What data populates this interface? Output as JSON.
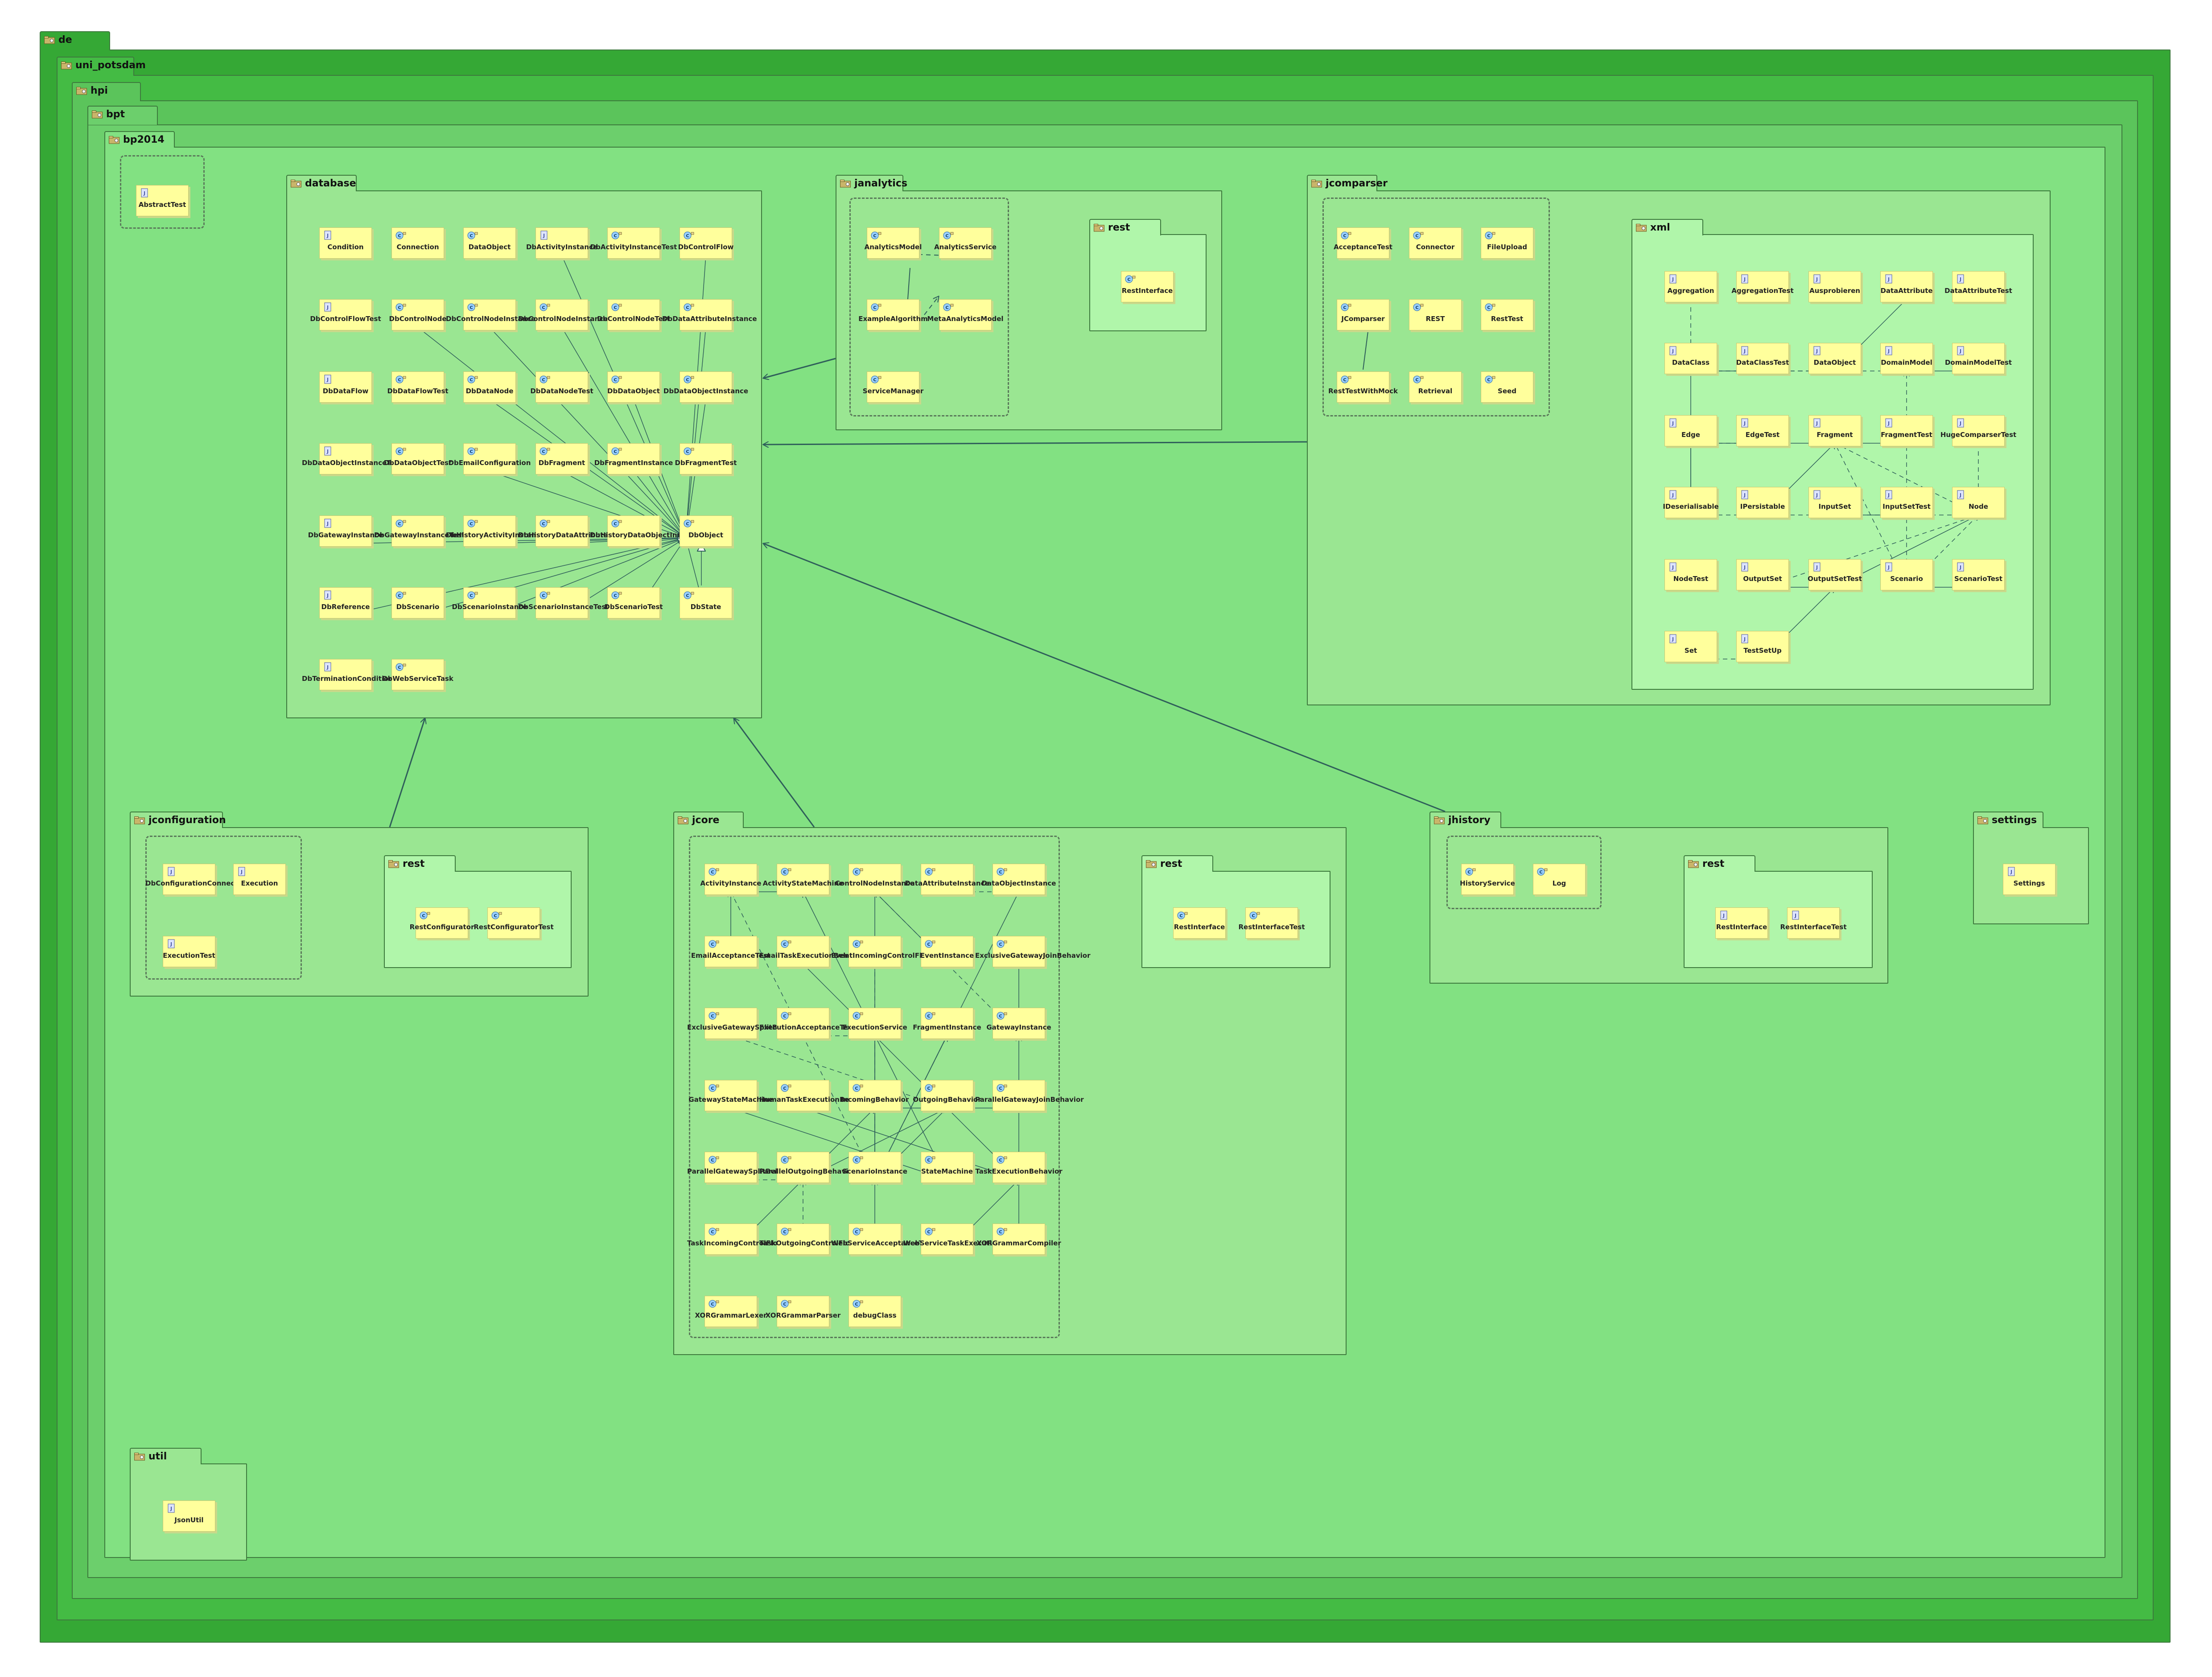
{
  "packages": [
    {
      "id": "de",
      "name": "de"
    },
    {
      "id": "uni_potsdam",
      "name": "uni_potsdam"
    },
    {
      "id": "hpi",
      "name": "hpi"
    },
    {
      "id": "bpt",
      "name": "bpt"
    },
    {
      "id": "bp2014",
      "name": "bp2014"
    },
    {
      "id": "database",
      "name": "database"
    },
    {
      "id": "janalytics",
      "name": "janalytics"
    },
    {
      "id": "janalytics_rest",
      "name": "rest"
    },
    {
      "id": "jcomparser",
      "name": "jcomparser"
    },
    {
      "id": "xml",
      "name": "xml"
    },
    {
      "id": "jconfiguration",
      "name": "jconfiguration"
    },
    {
      "id": "jconfiguration_rest",
      "name": "rest"
    },
    {
      "id": "jcore",
      "name": "jcore"
    },
    {
      "id": "jcore_rest",
      "name": "rest"
    },
    {
      "id": "jhistory",
      "name": "jhistory"
    },
    {
      "id": "jhistory_rest",
      "name": "rest"
    },
    {
      "id": "settings",
      "name": "settings"
    },
    {
      "id": "util",
      "name": "util"
    }
  ],
  "classes": [
    {
      "id": "AbstractTest",
      "name": "AbstractTest",
      "kind": "interface-icon"
    },
    {
      "id": "db_Condition",
      "name": "Condition",
      "kind": "interface-icon"
    },
    {
      "id": "db_Connection",
      "name": "Connection",
      "kind": "class-icon"
    },
    {
      "id": "db_DataObject",
      "name": "DataObject",
      "kind": "class-icon"
    },
    {
      "id": "db_DbActivityInstance",
      "name": "DbActivityInstance",
      "kind": "interface-icon"
    },
    {
      "id": "db_DbActivityInstanceTest",
      "name": "DbActivityInstanceTest",
      "kind": "class-icon"
    },
    {
      "id": "db_DbControlFlow",
      "name": "DbControlFlow",
      "kind": "class-icon"
    },
    {
      "id": "db_DbControlFlowTest",
      "name": "DbControlFlowTest",
      "kind": "interface-icon"
    },
    {
      "id": "db_DbControlNode",
      "name": "DbControlNode",
      "kind": "class-icon"
    },
    {
      "id": "db_DbControlNodeInstance",
      "name": "DbControlNodeInstance",
      "kind": "class-icon"
    },
    {
      "id": "db_DbControlNodeInstanceTest",
      "name": "DbControlNodeInstanceTest",
      "kind": "class-icon"
    },
    {
      "id": "db_DbControlNodeTest",
      "name": "DbControlNodeTest",
      "kind": "class-icon"
    },
    {
      "id": "db_DbDataAttributeInstance",
      "name": "DbDataAttributeInstance",
      "kind": "class-icon"
    },
    {
      "id": "db_DbDataFlow",
      "name": "DbDataFlow",
      "kind": "interface-icon"
    },
    {
      "id": "db_DbDataFlowTest",
      "name": "DbDataFlowTest",
      "kind": "class-icon"
    },
    {
      "id": "db_DbDataNode",
      "name": "DbDataNode",
      "kind": "class-icon"
    },
    {
      "id": "db_DbDataNodeTest",
      "name": "DbDataNodeTest",
      "kind": "class-icon"
    },
    {
      "id": "db_DbDataObject",
      "name": "DbDataObject",
      "kind": "class-icon"
    },
    {
      "id": "db_DbDataObjectInstance",
      "name": "DbDataObjectInstance",
      "kind": "class-icon"
    },
    {
      "id": "db_DbDataObjectInstanceTest",
      "name": "DbDataObjectInstanceTest",
      "kind": "interface-icon"
    },
    {
      "id": "db_DbDataObjectTest",
      "name": "DbDataObjectTest",
      "kind": "class-icon"
    },
    {
      "id": "db_DbEmailConfiguration",
      "name": "DbEmailConfiguration",
      "kind": "class-icon"
    },
    {
      "id": "db_DbFragment",
      "name": "DbFragment",
      "kind": "class-icon"
    },
    {
      "id": "db_DbFragmentInstance",
      "name": "DbFragmentInstance",
      "kind": "class-icon"
    },
    {
      "id": "db_DbFragmentTest",
      "name": "DbFragmentTest",
      "kind": "class-icon"
    },
    {
      "id": "db_DbGatewayInstance",
      "name": "DbGatewayInstance",
      "kind": "interface-icon"
    },
    {
      "id": "db_DbGatewayInstanceTest",
      "name": "DbGatewayInstanceTest",
      "kind": "class-icon"
    },
    {
      "id": "db_DbHistoryActivityInstance",
      "name": "DbHistoryActivityInstance",
      "kind": "class-icon"
    },
    {
      "id": "db_DbHistoryDataAttributeInstance",
      "name": "DbHistoryDataAttributeInstance",
      "kind": "class-icon"
    },
    {
      "id": "db_DbHistoryDataObjectInstance",
      "name": "DbHistoryDataObjectInstance",
      "kind": "class-icon"
    },
    {
      "id": "db_DbObject",
      "name": "DbObject",
      "kind": "class-icon"
    },
    {
      "id": "db_DbReference",
      "name": "DbReference",
      "kind": "interface-icon"
    },
    {
      "id": "db_DbScenario",
      "name": "DbScenario",
      "kind": "class-icon"
    },
    {
      "id": "db_DbScenarioInstance",
      "name": "DbScenarioInstance",
      "kind": "class-icon"
    },
    {
      "id": "db_DbScenarioInstanceTest",
      "name": "DbScenarioInstanceTest",
      "kind": "class-icon"
    },
    {
      "id": "db_DbScenarioTest",
      "name": "DbScenarioTest",
      "kind": "class-icon"
    },
    {
      "id": "db_DbState",
      "name": "DbState",
      "kind": "class-icon"
    },
    {
      "id": "db_DbTerminationCondition",
      "name": "DbTerminationCondition",
      "kind": "interface-icon"
    },
    {
      "id": "db_DbWebServiceTask",
      "name": "DbWebServiceTask",
      "kind": "class-icon"
    },
    {
      "id": "an_AnalyticsModel",
      "name": "AnalyticsModel",
      "kind": "class-icon"
    },
    {
      "id": "an_AnalyticsService",
      "name": "AnalyticsService",
      "kind": "class-icon"
    },
    {
      "id": "an_ExampleAlgorithm",
      "name": "ExampleAlgorithm",
      "kind": "class-icon"
    },
    {
      "id": "an_MetaAnalyticsModel",
      "name": "MetaAnalyticsModel",
      "kind": "class-icon"
    },
    {
      "id": "an_ServiceManager",
      "name": "ServiceManager",
      "kind": "class-icon"
    },
    {
      "id": "an_RestInterface",
      "name": "RestInterface",
      "kind": "class-icon"
    },
    {
      "id": "jc_AcceptanceTest",
      "name": "AcceptanceTest",
      "kind": "class-icon"
    },
    {
      "id": "jc_Connector",
      "name": "Connector",
      "kind": "class-icon"
    },
    {
      "id": "jc_FileUpload",
      "name": "FileUpload",
      "kind": "class-icon"
    },
    {
      "id": "jc_JComparser",
      "name": "JComparser",
      "kind": "class-icon"
    },
    {
      "id": "jc_REST",
      "name": "REST",
      "kind": "class-icon"
    },
    {
      "id": "jc_RestTest",
      "name": "RestTest",
      "kind": "class-icon"
    },
    {
      "id": "jc_RestTestWithMock",
      "name": "RestTestWithMock",
      "kind": "class-icon"
    },
    {
      "id": "jc_Retrieval",
      "name": "Retrieval",
      "kind": "class-icon"
    },
    {
      "id": "jc_Seed",
      "name": "Seed",
      "kind": "class-icon"
    },
    {
      "id": "x_Aggregation",
      "name": "Aggregation",
      "kind": "interface-icon"
    },
    {
      "id": "x_AggregationTest",
      "name": "AggregationTest",
      "kind": "interface-icon"
    },
    {
      "id": "x_Ausprobieren",
      "name": "Ausprobieren",
      "kind": "interface-icon"
    },
    {
      "id": "x_DataAttribute",
      "name": "DataAttribute",
      "kind": "interface-icon"
    },
    {
      "id": "x_DataAttributeTest",
      "name": "DataAttributeTest",
      "kind": "interface-icon"
    },
    {
      "id": "x_DataClass",
      "name": "DataClass",
      "kind": "interface-icon"
    },
    {
      "id": "x_DataClassTest",
      "name": "DataClassTest",
      "kind": "interface-icon"
    },
    {
      "id": "x_DataObject",
      "name": "DataObject",
      "kind": "interface-icon"
    },
    {
      "id": "x_DomainModel",
      "name": "DomainModel",
      "kind": "interface-icon"
    },
    {
      "id": "x_DomainModelTest",
      "name": "DomainModelTest",
      "kind": "interface-icon"
    },
    {
      "id": "x_Edge",
      "name": "Edge",
      "kind": "interface-icon"
    },
    {
      "id": "x_EdgeTest",
      "name": "EdgeTest",
      "kind": "interface-icon"
    },
    {
      "id": "x_Fragment",
      "name": "Fragment",
      "kind": "interface-icon"
    },
    {
      "id": "x_FragmentTest",
      "name": "FragmentTest",
      "kind": "interface-icon"
    },
    {
      "id": "x_HugeComparserTest",
      "name": "HugeComparserTest",
      "kind": "interface-icon"
    },
    {
      "id": "x_IDeserialisable",
      "name": "IDeserialisable",
      "kind": "interface-icon"
    },
    {
      "id": "x_IPersistable",
      "name": "IPersistable",
      "kind": "interface-icon"
    },
    {
      "id": "x_InputSet",
      "name": "InputSet",
      "kind": "interface-icon"
    },
    {
      "id": "x_InputSetTest",
      "name": "InputSetTest",
      "kind": "interface-icon"
    },
    {
      "id": "x_Node",
      "name": "Node",
      "kind": "interface-icon"
    },
    {
      "id": "x_NodeTest",
      "name": "NodeTest",
      "kind": "interface-icon"
    },
    {
      "id": "x_OutputSet",
      "name": "OutputSet",
      "kind": "interface-icon"
    },
    {
      "id": "x_OutputSetTest",
      "name": "OutputSetTest",
      "kind": "interface-icon"
    },
    {
      "id": "x_Scenario",
      "name": "Scenario",
      "kind": "interface-icon"
    },
    {
      "id": "x_ScenarioTest",
      "name": "ScenarioTest",
      "kind": "interface-icon"
    },
    {
      "id": "x_Set",
      "name": "Set",
      "kind": "interface-icon"
    },
    {
      "id": "x_TestSetUp",
      "name": "TestSetUp",
      "kind": "interface-icon"
    },
    {
      "id": "cf_DbConfigurationConnection",
      "name": "DbConfigurationConnection",
      "kind": "interface-icon"
    },
    {
      "id": "cf_Execution",
      "name": "Execution",
      "kind": "interface-icon"
    },
    {
      "id": "cf_ExecutionTest",
      "name": "ExecutionTest",
      "kind": "interface-icon"
    },
    {
      "id": "cf_RestConfigurator",
      "name": "RestConfigurator",
      "kind": "class-icon"
    },
    {
      "id": "cf_RestConfiguratorTest",
      "name": "RestConfiguratorTest",
      "kind": "class-icon"
    },
    {
      "id": "co_ActivityInstance",
      "name": "ActivityInstance",
      "kind": "class-icon"
    },
    {
      "id": "co_ActivityStateMachine",
      "name": "ActivityStateMachine",
      "kind": "class-icon"
    },
    {
      "id": "co_ControlNodeInstance",
      "name": "ControlNodeInstance",
      "kind": "class-icon"
    },
    {
      "id": "co_DataAttributeInstance",
      "name": "DataAttributeInstance",
      "kind": "class-icon"
    },
    {
      "id": "co_DataObjectInstance",
      "name": "DataObjectInstance",
      "kind": "class-icon"
    },
    {
      "id": "co_EmailAcceptanceTest",
      "name": "EmailAcceptanceTest",
      "kind": "class-icon"
    },
    {
      "id": "co_EmailTaskExecutionBehavior",
      "name": "EmailTaskExecutionBehavior",
      "kind": "class-icon"
    },
    {
      "id": "co_EventIncomingControlFlowBehavior",
      "name": "EventIncomingControlFlowBehavior",
      "kind": "class-icon"
    },
    {
      "id": "co_EventInstance",
      "name": "EventInstance",
      "kind": "class-icon"
    },
    {
      "id": "co_ExclusiveGatewayJoinBehavior",
      "name": "ExclusiveGatewayJoinBehavior",
      "kind": "class-icon"
    },
    {
      "id": "co_ExclusiveGatewaySplitBehavior",
      "name": "ExclusiveGatewaySplitBehavior",
      "kind": "class-icon"
    },
    {
      "id": "co_ExecutionAcceptanceTest",
      "name": "ExecutionAcceptanceTest",
      "kind": "class-icon"
    },
    {
      "id": "co_ExecutionService",
      "name": "ExecutionService",
      "kind": "class-icon"
    },
    {
      "id": "co_FragmentInstance",
      "name": "FragmentInstance",
      "kind": "class-icon"
    },
    {
      "id": "co_GatewayInstance",
      "name": "GatewayInstance",
      "kind": "class-icon"
    },
    {
      "id": "co_GatewayStateMachine",
      "name": "GatewayStateMachine",
      "kind": "class-icon"
    },
    {
      "id": "co_HumanTaskExecutionBehavior",
      "name": "HumanTaskExecutionBehavior",
      "kind": "class-icon"
    },
    {
      "id": "co_IncomingBehavior",
      "name": "IncomingBehavior",
      "kind": "class-icon"
    },
    {
      "id": "co_OutgoingBehavior",
      "name": "OutgoingBehavior",
      "kind": "class-icon"
    },
    {
      "id": "co_ParallelGatewayJoinBehavior",
      "name": "ParallelGatewayJoinBehavior",
      "kind": "class-icon"
    },
    {
      "id": "co_ParallelGatewaySplitBehavior",
      "name": "ParallelGatewaySplitBehavior",
      "kind": "class-icon"
    },
    {
      "id": "co_ParallelOutgoingBehavior",
      "name": "ParallelOutgoingBehavior",
      "kind": "class-icon"
    },
    {
      "id": "co_ScenarioInstance",
      "name": "ScenarioInstance",
      "kind": "class-icon"
    },
    {
      "id": "co_StateMachine",
      "name": "StateMachine",
      "kind": "class-icon"
    },
    {
      "id": "co_TaskExecutionBehavior",
      "name": "TaskExecutionBehavior",
      "kind": "class-icon"
    },
    {
      "id": "co_TaskIncomingControlFlowBehavior",
      "name": "TaskIncomingControlFlowBehavior",
      "kind": "class-icon"
    },
    {
      "id": "co_TaskOutgoingControlFlowBehavior",
      "name": "TaskOutgoingControlFlowBehavior",
      "kind": "class-icon"
    },
    {
      "id": "co_WebServiceAcceptanceTest",
      "name": "WebServiceAcceptanceTest",
      "kind": "class-icon"
    },
    {
      "id": "co_WebServiceTaskExecutionBehavior",
      "name": "WebServiceTaskExecutionBehavior",
      "kind": "class-icon"
    },
    {
      "id": "co_XORGrammarCompiler",
      "name": "XORGrammarCompiler",
      "kind": "class-icon"
    },
    {
      "id": "co_XORGrammarLexer",
      "name": "XORGrammarLexer",
      "kind": "class-icon"
    },
    {
      "id": "co_XORGrammarParser",
      "name": "XORGrammarParser",
      "kind": "class-icon"
    },
    {
      "id": "co_debugClass",
      "name": "debugClass",
      "kind": "class-icon"
    },
    {
      "id": "co_RestInterface",
      "name": "RestInterface",
      "kind": "class-icon"
    },
    {
      "id": "co_RestInterfaceTest",
      "name": "RestInterfaceTest",
      "kind": "class-icon"
    },
    {
      "id": "hi_HistoryService",
      "name": "HistoryService",
      "kind": "class-icon"
    },
    {
      "id": "hi_Log",
      "name": "Log",
      "kind": "class-icon"
    },
    {
      "id": "hi_RestInterface",
      "name": "RestInterface",
      "kind": "interface-icon"
    },
    {
      "id": "hi_RestInterfaceTest",
      "name": "RestInterfaceTest",
      "kind": "interface-icon"
    },
    {
      "id": "st_Settings",
      "name": "Settings",
      "kind": "interface-icon"
    },
    {
      "id": "ut_JsonUtil",
      "name": "JsonUtil",
      "kind": "interface-icon"
    }
  ],
  "colors": {
    "level1": "#35a835",
    "level2": "#44bb44",
    "level3": "#5bc45b",
    "level4": "#6ccf6c",
    "level5": "#82e182",
    "module": "#9ae692",
    "rest": "#b0f6aa",
    "class_fill": "#ffff9c",
    "edge": "#2f5f5a"
  }
}
